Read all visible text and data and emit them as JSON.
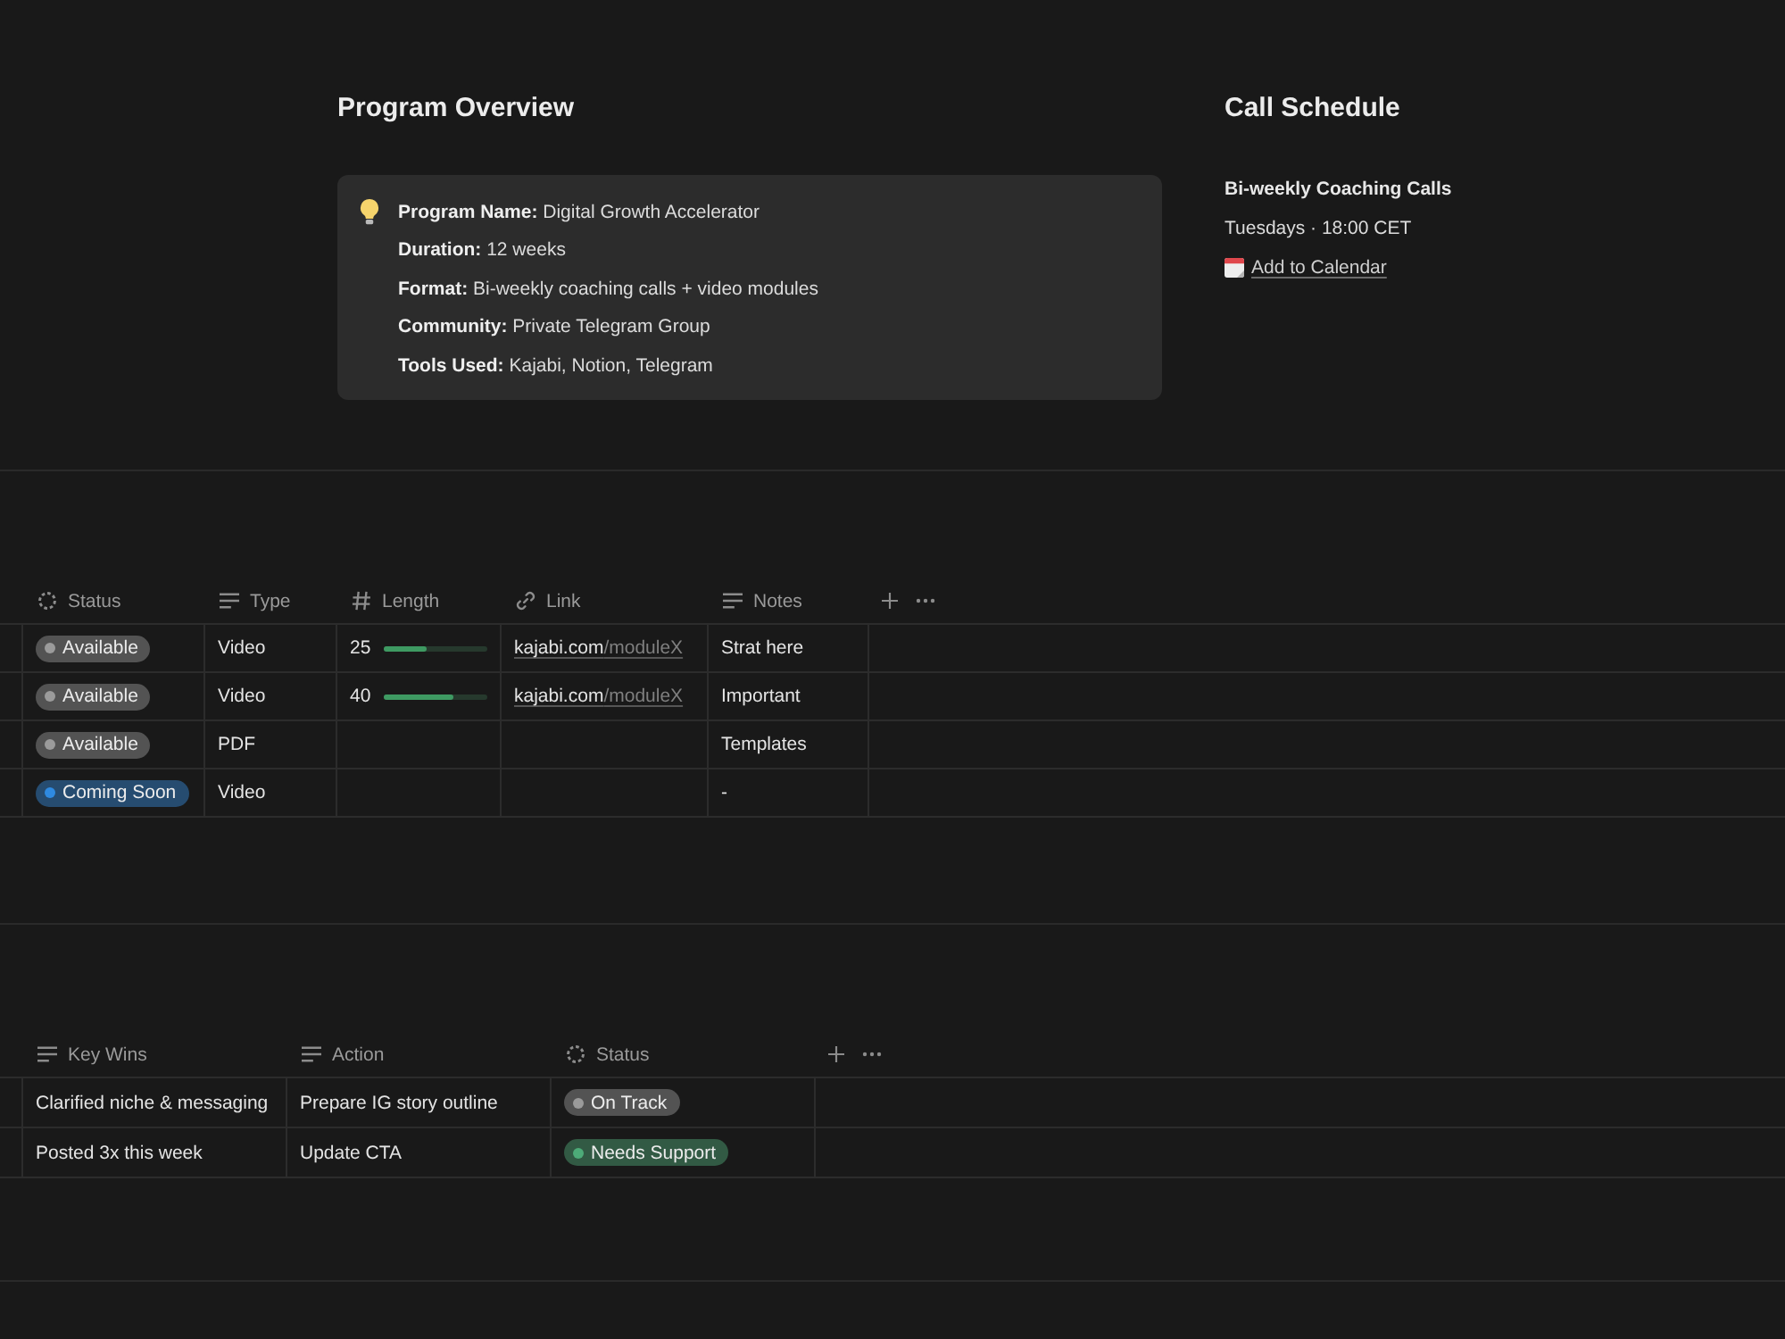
{
  "program_overview": {
    "title": "Program Overview",
    "callout": {
      "lines": [
        "**Program Name:** Digital Growth Accelerator",
        "**Duration:** 12 weeks",
        "**Format:** Bi-weekly coaching calls + video modules",
        "**Community:** Private Telegram Group",
        "**Tools Used:** Kajabi, Notion, Telegram"
      ]
    }
  },
  "call_schedule": {
    "title": "Call Schedule",
    "event": "Bi-weekly Coaching Calls",
    "time": "Tuesdays · 18:00 CET",
    "link": "Add to Calendar"
  },
  "modules_table": {
    "columns": [
      {
        "label": "Status",
        "kind": "status"
      },
      {
        "label": "Type",
        "kind": "text"
      },
      {
        "label": "Length",
        "kind": "number"
      },
      {
        "label": "Link",
        "kind": "url"
      },
      {
        "label": "Notes",
        "kind": "text"
      }
    ],
    "rows": [
      {
        "status": {
          "label": "Available",
          "color": "#9b9b9b"
        },
        "type": "Video",
        "length": {
          "value": "25",
          "level": 0.42
        },
        "link": {
          "host": "kajabi.com",
          "path": "/moduleX"
        },
        "notes": "Strat here"
      },
      {
        "status": {
          "label": "Available",
          "color": "#9b9b9b"
        },
        "type": "Video",
        "length": {
          "value": "40",
          "level": 0.67
        },
        "link": {
          "host": "kajabi.com",
          "path": "/moduleX"
        },
        "notes": "Important"
      },
      {
        "status": {
          "label": "Available",
          "color": "#9b9b9b"
        },
        "type": "PDF",
        "notes": "Templates"
      },
      {
        "status": {
          "label": "Coming Soon",
          "color": "#2f8ae0"
        },
        "type": "Video",
        "notes": "-"
      }
    ]
  },
  "progress_table": {
    "columns": [
      {
        "label": "Key Wins",
        "kind": "text"
      },
      {
        "label": "Action",
        "kind": "text"
      },
      {
        "label": "Status",
        "kind": "status"
      }
    ],
    "rows": [
      {
        "key_win": "Clarified niche & messaging",
        "action": "Prepare IG story outline",
        "status": {
          "label": "On Track",
          "color": "#9b9b9b"
        }
      },
      {
        "key_win": "Posted 3x this week",
        "action": "Update CTA",
        "status": {
          "label": "Needs Support",
          "color": "#4dab78"
        }
      }
    ]
  }
}
